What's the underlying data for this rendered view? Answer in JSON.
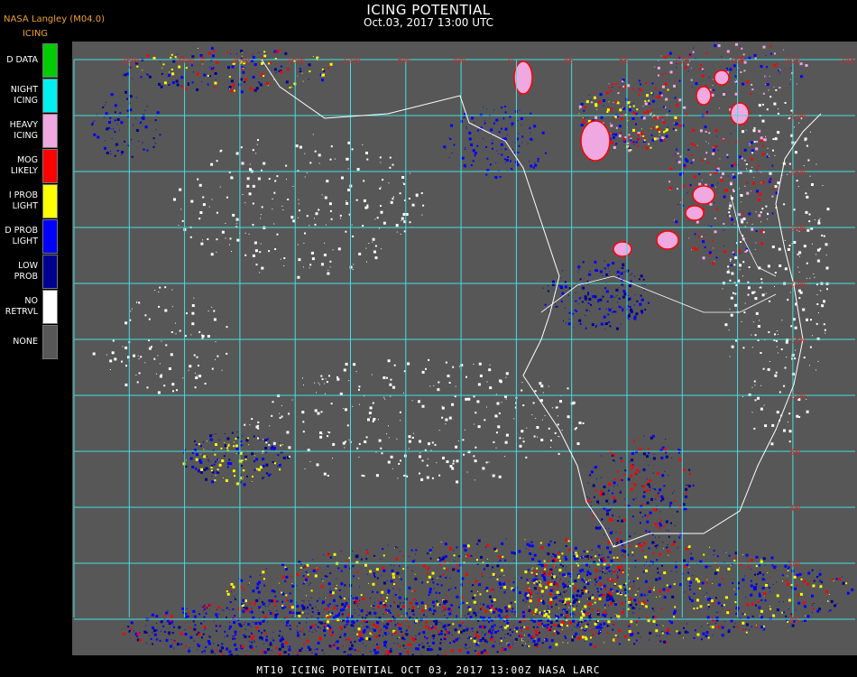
{
  "header": {
    "agency": "NASA Langley (M04.0)",
    "product": "ICING",
    "title": "ICING POTENTIAL",
    "datetime": "Oct.03, 2017 13:00 UTC"
  },
  "legend": [
    {
      "label": "D DATA",
      "color": "#00cc00"
    },
    {
      "label": "NIGHT\nICING",
      "color": "#00f0f0"
    },
    {
      "label": "HEAVY\nICING",
      "color": "#f0a8e0"
    },
    {
      "label": "MOG\nLIKELY",
      "color": "#ff0000"
    },
    {
      "label": "I PROB\nLIGHT",
      "color": "#ffff00"
    },
    {
      "label": "D PROB\nLIGHT",
      "color": "#0000ff"
    },
    {
      "label": "LOW\nPROB",
      "color": "#000090"
    },
    {
      "label": "NO\nRETRVL",
      "color": "#ffffff"
    },
    {
      "label": "NONE",
      "color": "#575757"
    }
  ],
  "map": {
    "background": "#575757",
    "grid_color": "#40e0e0",
    "coast_color": "#ffffff",
    "lon_labels": [
      "28W",
      "24W",
      "20W",
      "16W",
      "12W",
      "8W",
      "4W",
      "0",
      "4E",
      "8E",
      "12E",
      "16E",
      "20E",
      "24E",
      "28E"
    ],
    "lat_labels": [
      "32N",
      "28N",
      "24N",
      "20N",
      "16N",
      "12N",
      "8N",
      "4N",
      "0N",
      "4S"
    ]
  },
  "footer": {
    "text": "MT10  ICING POTENTIAL   OCT 03, 2017 13:00Z   NASA LARC"
  }
}
